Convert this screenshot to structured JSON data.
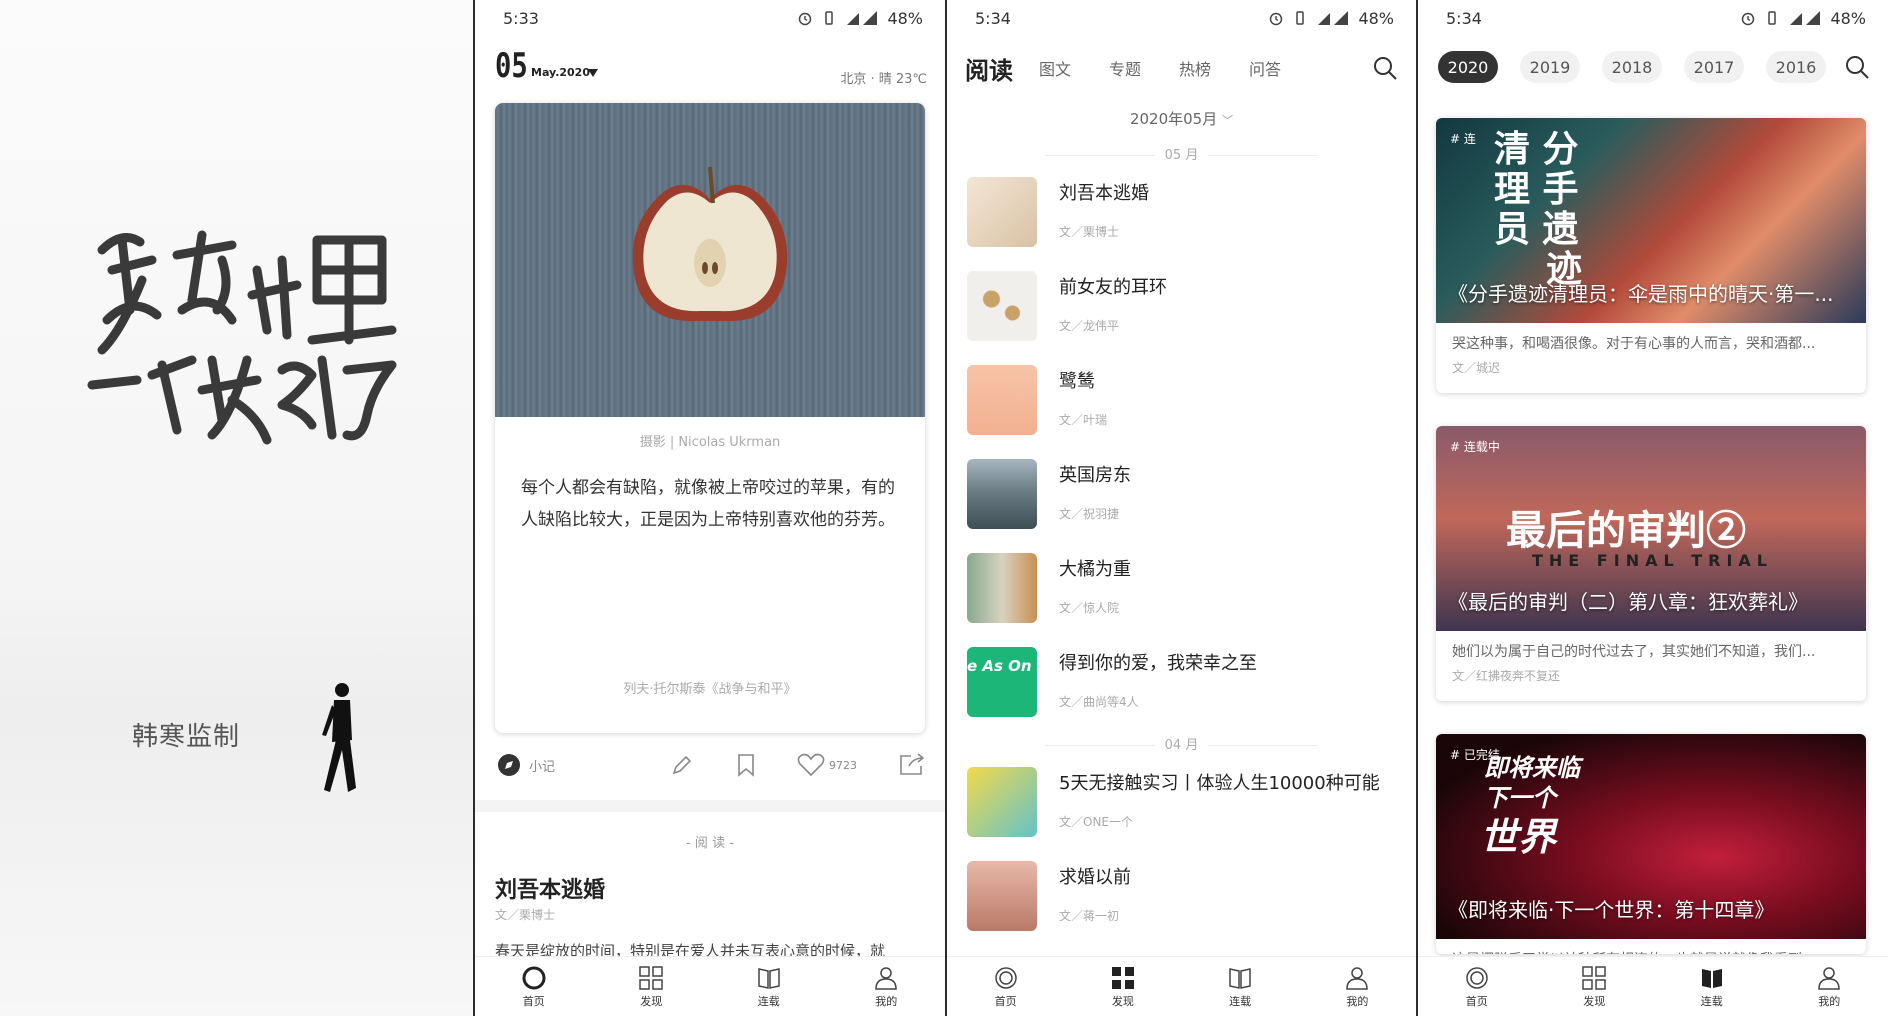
{
  "panel1": {
    "calligraphy": "复杂世界里，一个就够了",
    "credit": "韩寒监制"
  },
  "panel2": {
    "status": {
      "time": "5:33",
      "battery": "48%"
    },
    "date": {
      "day": "05",
      "month_year": "May.2020"
    },
    "weather": "北京 · 晴  23℃",
    "card": {
      "photo_caption": "摄影 | Nicolas Ukrman",
      "quote": "每个人都会有缺陷，就像被上帝咬过的苹果，有的人缺陷比较大，正是因为上帝特别喜欢他的芬芳。",
      "source": "列夫·托尔斯泰《战争与和平》"
    },
    "actions": {
      "note_label": "小记",
      "like_count": "9723"
    },
    "read": {
      "section_label": "- 阅 读 -",
      "title": "刘吾本逃婚",
      "author": "文／栗博士",
      "excerpt": "春天是绽放的时间，特别是在爱人并未互表心意的时候，就"
    },
    "tabs": [
      "首页",
      "发现",
      "连载",
      "我的"
    ]
  },
  "panel3": {
    "status": {
      "time": "5:34",
      "battery": "48%"
    },
    "nav": {
      "current": "阅读",
      "items": [
        "图文",
        "专题",
        "热榜",
        "问答"
      ]
    },
    "month_selector": "2020年05月",
    "groups": [
      "05 月",
      "04 月"
    ],
    "articles": [
      {
        "title": "刘吾本逃婚",
        "author": "文／栗博士"
      },
      {
        "title": "前女友的耳环",
        "author": "文／龙伟平"
      },
      {
        "title": "鹭鸶",
        "author": "文／叶瑞"
      },
      {
        "title": "英国房东",
        "author": "文／祝羽捷"
      },
      {
        "title": "大橘为重",
        "author": "文／惊人院"
      },
      {
        "title": "得到你的爱，我荣幸之至",
        "author": "文／曲尚等4人"
      },
      {
        "title": "5天无接触实习丨体验人生10000种可能",
        "author": "文／ONE一个"
      },
      {
        "title": "求婚以前",
        "author": "文／蒋一初"
      }
    ],
    "thumb_text": "e As On",
    "tabs": [
      "首页",
      "发现",
      "连载",
      "我的"
    ]
  },
  "panel4": {
    "status": {
      "time": "5:34",
      "battery": "48%"
    },
    "years": [
      "2020",
      "2019",
      "2018",
      "2017",
      "2016"
    ],
    "serials": [
      {
        "tag": "# 连",
        "cover_text": [
          "清 分",
          "理 手",
          "员 遗",
          "迹"
        ],
        "title": "《分手遗迹清理员：伞是雨中的晴天·第一...",
        "excerpt": "哭这种事，和喝酒很像。对于有心事的人而言，哭和酒都...",
        "author": "文／城迟"
      },
      {
        "tag": "# 连载中",
        "cover_text": [
          "最后的审判②",
          "THE FINAL TRIAL"
        ],
        "title": "《最后的审判（二）第八章：狂欢葬礼》",
        "excerpt": "她们以为属于自己的时代过去了，其实她们不知道，我们...",
        "author": "文／红拂夜奔不复还"
      },
      {
        "tag": "# 已完结",
        "cover_text": [
          "即将来临",
          "下一个",
          "世界"
        ],
        "title": "《即将来临·下一个世界：第十四章》",
        "excerpt": "这是摆脱后平常以社种所有相连的，也就是说就像我看到",
        "author": ""
      }
    ],
    "tabs": [
      "首页",
      "发现",
      "连载",
      "我的"
    ]
  },
  "colors": {
    "accent_dark": "#333333",
    "muted": "#aaaaaa",
    "divider": "#f4f4f4"
  }
}
